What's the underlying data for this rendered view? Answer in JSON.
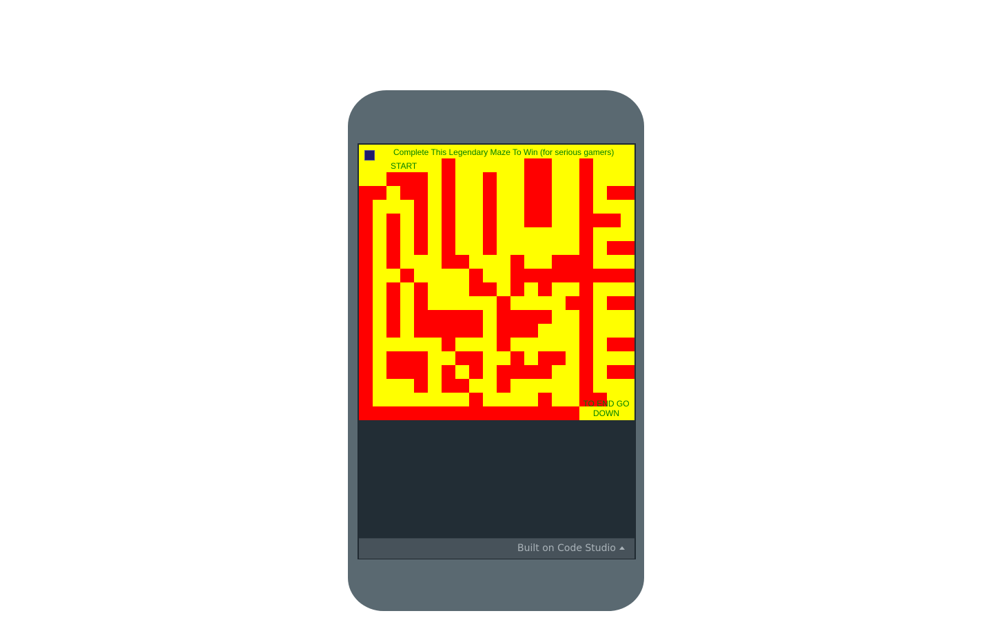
{
  "app": {
    "title": "Complete This Legendary Maze To Win (for serious gamers)",
    "start_label": "START",
    "end_label": "TO END GO DOWN",
    "footer_label": "Built on Code Studio"
  },
  "colors": {
    "wall": "#ff0000",
    "path": "#ffff00",
    "label_text": "#008000",
    "player": "#1f1a6b",
    "phone_frame": "#5a6971",
    "screen_bg": "#222d35"
  },
  "icons": {
    "footer_caret": "caret-up-icon",
    "player": "player-square"
  },
  "maze": {
    "columns": 20,
    "rows": 20,
    "legend": "# = wall, . = path",
    "grid": [
      "....................",
      "......#.....##..#...",
      "..###.#..#..##..#...",
      "##.##.#..#..##..#.##",
      "#...#.#..#..##..#...",
      "#.#.#.#..#..##..###.",
      "#.#.#.#..#......#...",
      "#.#.#.#..#......#.##",
      "#.#...##...#..###...",
      "#..#....#..#########.",
      "#.#.#...##.#.#..#...",
      "#.#.#.....#....##.##",
      "#.#.#####.####..#...",
      "#.#.#####.###...#...",
      "#.....#...#.....#.##",
      "#.###..##..#.##.#...",
      "#.###.#.#.####..#.##",
      "#...#.##..#.....#...",
      "#.......#....#..##..",
      "################...."
    ]
  }
}
